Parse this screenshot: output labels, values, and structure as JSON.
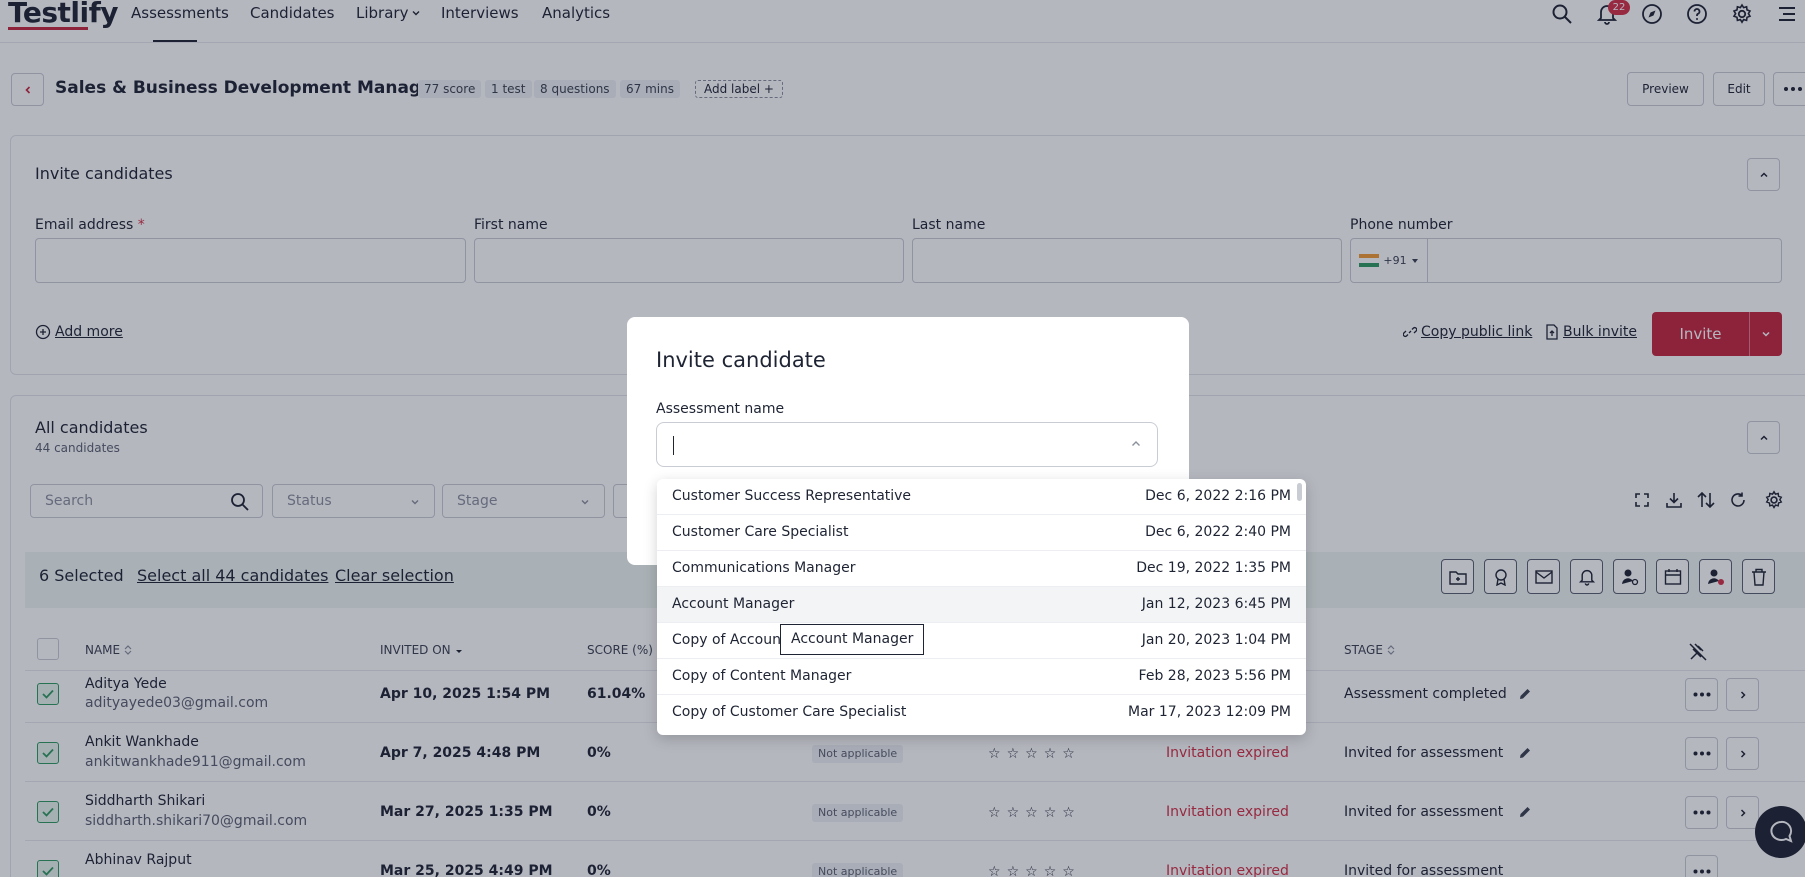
{
  "app": {
    "logo_text": "Testlify"
  },
  "nav": {
    "items": [
      {
        "label": "Assessments"
      },
      {
        "label": "Candidates"
      },
      {
        "label": "Library"
      },
      {
        "label": "Interviews"
      },
      {
        "label": "Analytics"
      }
    ],
    "notification_count": "22"
  },
  "assessment": {
    "title": "Sales & Business Development Manager",
    "chips": [
      "77 score",
      "1 test",
      "8 questions",
      "67 mins"
    ],
    "add_label": "Add label +",
    "preview_label": "Preview",
    "edit_label": "Edit"
  },
  "invite_panel": {
    "title": "Invite candidates",
    "email_label": "Email address",
    "required_mark": "*",
    "first_name_label": "First name",
    "last_name_label": "Last name",
    "phone_label": "Phone number",
    "phone_prefix": "+91",
    "add_more": "Add more",
    "copy_public_link": "Copy public link",
    "bulk_invite": "Bulk invite",
    "invite_button": "Invite"
  },
  "candidates_panel": {
    "title": "All candidates",
    "count": "44 candidates",
    "search_placeholder": "Search",
    "status_placeholder": "Status",
    "stage_placeholder": "Stage",
    "selected_text": "6 Selected",
    "select_all": "Select all 44 candidates",
    "clear_selection": "Clear selection"
  },
  "table": {
    "headers": {
      "name": "NAME",
      "invited_on": "INVITED ON",
      "score": "SCORE (%)",
      "stage": "STAGE"
    },
    "rows": [
      {
        "name": "Aditya Yede",
        "email": "adityayede03@gmail.com",
        "invited_on": "Apr 10, 2025 1:54 PM",
        "score": "61.04%",
        "stage": "Assessment completed"
      },
      {
        "name": "Ankit Wankhade",
        "email": "ankitwankhade911@gmail.com",
        "invited_on": "Apr 7, 2025 4:48 PM",
        "score": "0%",
        "rating": "Not applicable",
        "status": "Invitation expired",
        "stage": "Invited for assessment"
      },
      {
        "name": "Siddharth Shikari",
        "email": "siddharth.shikari70@gmail.com",
        "invited_on": "Mar 27, 2025 1:35 PM",
        "score": "0%",
        "rating": "Not applicable",
        "status": "Invitation expired",
        "stage": "Invited for assessment"
      },
      {
        "name": "Abhinav Rajput",
        "email": "",
        "invited_on": "Mar 25, 2025 4:49 PM",
        "score": "0%",
        "rating": "Not applicable",
        "status": "Invitation expired",
        "stage": "Invited for assessment"
      }
    ]
  },
  "modal": {
    "title": "Invite candidate",
    "field_label": "Assessment name",
    "input_value": ""
  },
  "dropdown": {
    "options": [
      {
        "name": "Customer Success Representative",
        "date": "Dec 6, 2022 2:16 PM"
      },
      {
        "name": "Customer Care Specialist",
        "date": "Dec 6, 2022 2:40 PM"
      },
      {
        "name": "Communications Manager",
        "date": "Dec 19, 2022 1:35 PM"
      },
      {
        "name": "Account Manager",
        "date": "Jan 12, 2023 6:45 PM"
      },
      {
        "name": "Copy of Account",
        "date": "Jan 20, 2023 1:04 PM"
      },
      {
        "name": "Copy of Content Manager",
        "date": "Feb 28, 2023 5:56 PM"
      },
      {
        "name": "Copy of Customer Care Specialist",
        "date": "Mar 17, 2023 12:09 PM"
      }
    ],
    "highlighted_index": 3,
    "tooltip": "Account Manager"
  },
  "colors": {
    "brand_red": "#c4253d",
    "expired_red": "#d32f45",
    "check_green": "#2e9a5f"
  },
  "icons": [
    "search-icon",
    "bell-icon",
    "compass-icon",
    "help-icon",
    "gear-icon",
    "menu-icon",
    "chevron-left-icon",
    "chevron-up-icon",
    "chevron-down-icon",
    "plus-circle-icon",
    "link-icon",
    "upload-icon",
    "expand-icon",
    "download-icon",
    "sort-icon",
    "refresh-icon",
    "star-icon",
    "edit-icon",
    "ellipsis-icon",
    "chevron-right-icon",
    "chat-icon"
  ]
}
